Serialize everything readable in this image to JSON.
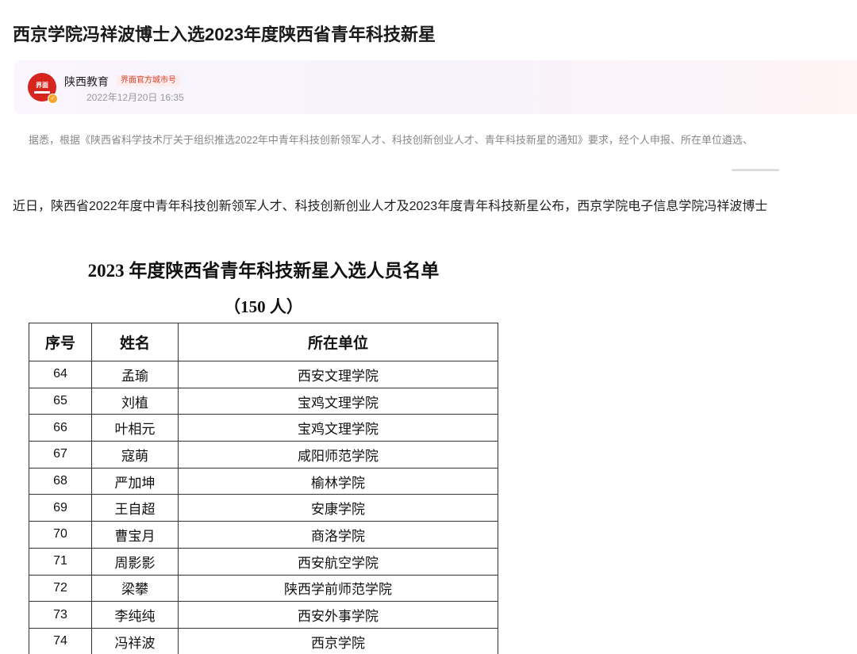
{
  "article": {
    "title": "西京学院冯祥波博士入选2023年度陕西省青年科技新星"
  },
  "author": {
    "avatar_text": "界面",
    "name": "陕西教育",
    "tag": "界面官方城市号",
    "publish_time": "2022年12月20日 16:35"
  },
  "summary": "据悉，根据《陕西省科学技术厅关于组织推选2022年中青年科技创新领军人才、科技创新创业人才、青年科技新星的通知》要求，经个人申报、所在单位遴选、",
  "intro": "近日，陕西省2022年度中青年科技创新领军人才、科技创新创业人才及2023年度青年科技新星公布，西京学院电子信息学院冯祥波博士",
  "document": {
    "title": "2023 年度陕西省青年科技新星入选人员名单",
    "subtitle": "（150 人）",
    "columns": [
      "序号",
      "姓名",
      "所在单位"
    ],
    "rows": [
      {
        "no": "64",
        "name": "孟瑜",
        "unit": "西安文理学院"
      },
      {
        "no": "65",
        "name": "刘植",
        "unit": "宝鸡文理学院"
      },
      {
        "no": "66",
        "name": "叶相元",
        "unit": "宝鸡文理学院"
      },
      {
        "no": "67",
        "name": "寇萌",
        "unit": "咸阳师范学院"
      },
      {
        "no": "68",
        "name": "严加坤",
        "unit": "榆林学院"
      },
      {
        "no": "69",
        "name": "王自超",
        "unit": "安康学院"
      },
      {
        "no": "70",
        "name": "曹宝月",
        "unit": "商洛学院"
      },
      {
        "no": "71",
        "name": "周影影",
        "unit": "西安航空学院"
      },
      {
        "no": "72",
        "name": "梁攀",
        "unit": "陕西学前师范学院"
      },
      {
        "no": "73",
        "name": "李纯纯",
        "unit": "西安外事学院"
      },
      {
        "no": "74",
        "name": "冯祥波",
        "unit": "西京学院"
      }
    ]
  }
}
